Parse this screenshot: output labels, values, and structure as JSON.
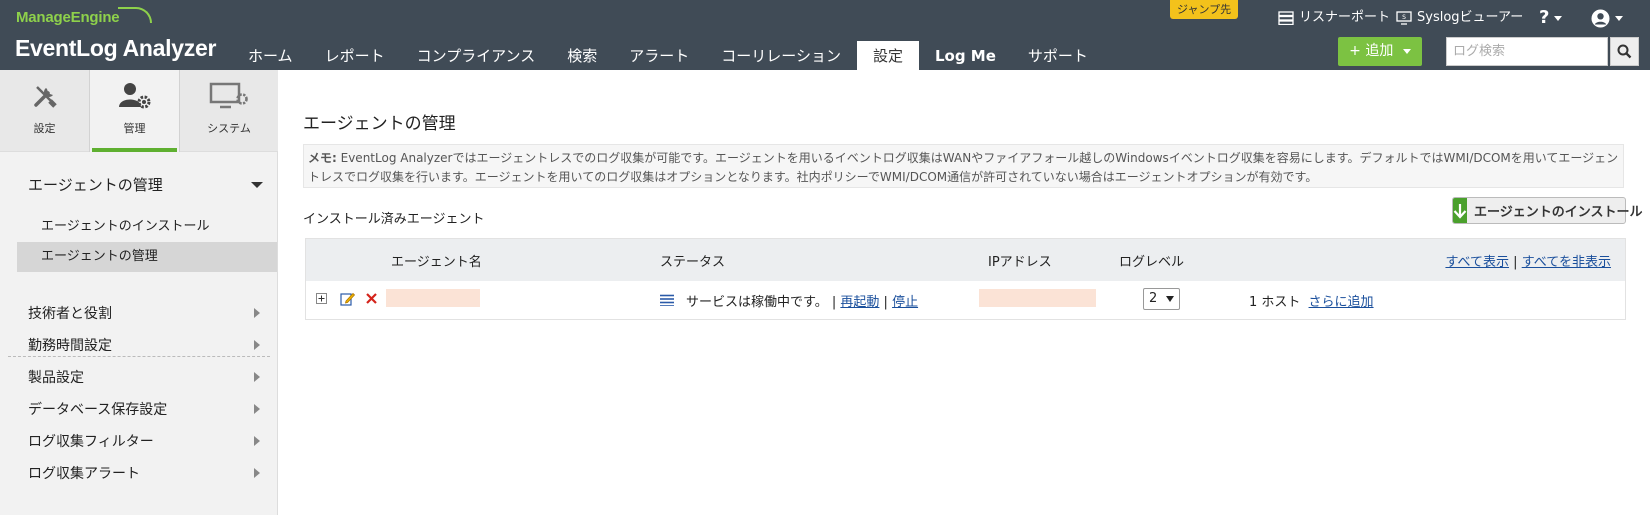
{
  "header": {
    "logo_small": "ManageEngine",
    "logo_main": "EventLog Analyzer",
    "jump_label": "ジャンプ先",
    "listener_port": "リスナーポート",
    "syslog_viewer": "Syslogビューアー",
    "help": "?",
    "add_button": "+ 追加",
    "search_placeholder": "ログ検索",
    "brand_color": "#7cc242",
    "header_bg": "#404b56"
  },
  "nav": {
    "tabs": [
      {
        "label": "ホーム"
      },
      {
        "label": "レポート"
      },
      {
        "label": "コンプライアンス"
      },
      {
        "label": "検索"
      },
      {
        "label": "アラート"
      },
      {
        "label": "コーリレーション"
      },
      {
        "label": "設定",
        "active": true
      },
      {
        "label": "Log Me"
      },
      {
        "label": "サポート"
      }
    ]
  },
  "sidebar": {
    "tabs": [
      {
        "label": "設定",
        "icon": "tools-icon"
      },
      {
        "label": "管理",
        "icon": "user-gear-icon",
        "active": true
      },
      {
        "label": "システム",
        "icon": "monitor-gear-icon"
      }
    ],
    "section_title": "エージェントの管理",
    "sub_items": [
      {
        "label": "エージェントのインストール"
      },
      {
        "label": "エージェントの管理",
        "active": true
      }
    ],
    "items": [
      {
        "label": "技術者と役割"
      },
      {
        "label": "勤務時間設定"
      },
      {
        "label": "製品設定"
      },
      {
        "label": "データベース保存設定"
      },
      {
        "label": "ログ収集フィルター"
      },
      {
        "label": "ログ収集アラート"
      }
    ]
  },
  "main": {
    "title": "エージェントの管理",
    "memo_label": "メモ:",
    "memo_text": " EventLog Analyzerではエージェントレスでのログ収集が可能です。エージェントを用いるイベントログ収集はWANやファイアフォール越しのWindowsイベントログ収集を容易にします。デフォルトではWMI/DCOMを用いてエージェントレスでログ収集を行います。エージェントを用いてのログ収集はオプションとなります。社内ポリシーでWMI/DCOM通信が許可されていない場合はエージェントオプションが有効です。",
    "installed_label": "インストール済みエージェント",
    "install_button": "エージェントのインストール",
    "table": {
      "headers": {
        "agent_name": "エージェント名",
        "status": "ステータス",
        "ip": "IPアドレス",
        "log_level": "ログレベル"
      },
      "show_all": "すべて表示",
      "separator": "|",
      "hide_all": "すべてを非表示",
      "rows": [
        {
          "status_text": "サービスは稼働中です。",
          "sep": "|",
          "restart": "再起動",
          "stop": "停止",
          "log_level": "2",
          "hosts": "1 ホスト",
          "add_more": "さらに追加"
        }
      ]
    }
  }
}
